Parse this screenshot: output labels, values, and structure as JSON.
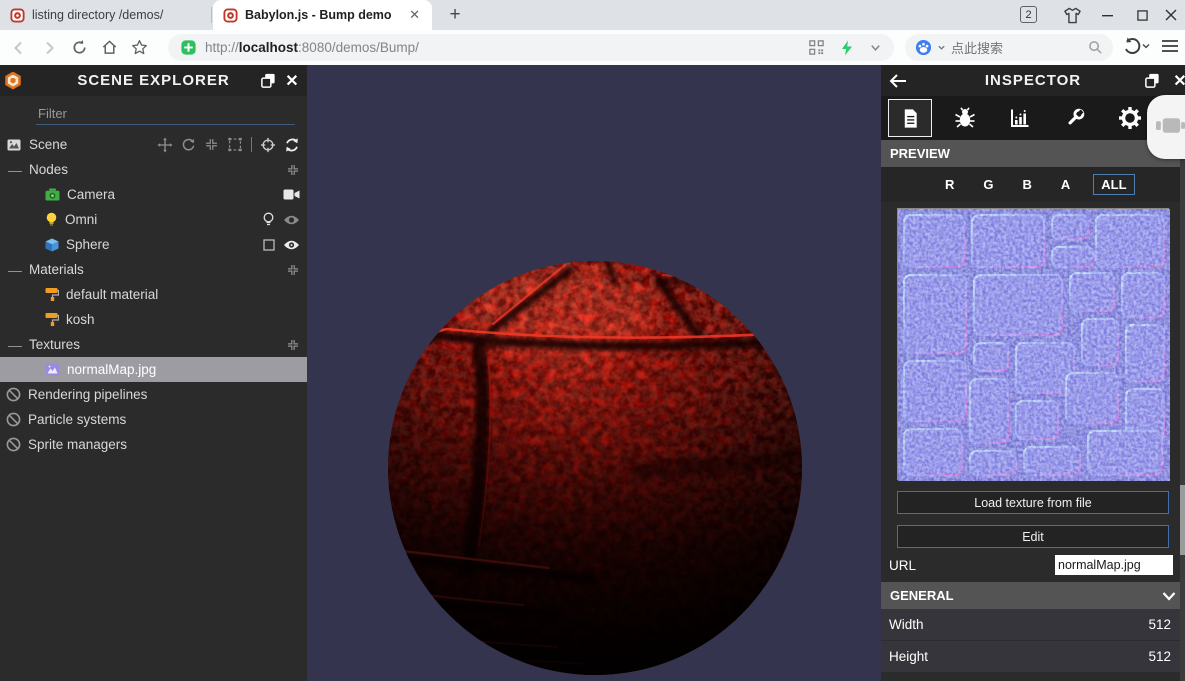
{
  "browser": {
    "tabs": [
      {
        "title": "listing directory /demos/"
      },
      {
        "title": "Babylon.js - Bump demo"
      }
    ],
    "new_tab_label": "+",
    "window_badge": "2",
    "url": {
      "prefix": "http://",
      "host": "localhost",
      "rest": ":8080/demos/Bump/"
    },
    "search_placeholder": "点此搜索"
  },
  "explorer": {
    "title": "SCENE EXPLORER",
    "filter_placeholder": "Filter",
    "rows": [
      {
        "label": "Scene"
      },
      {
        "label": "Nodes"
      },
      {
        "label": "Camera"
      },
      {
        "label": "Omni"
      },
      {
        "label": "Sphere"
      },
      {
        "label": "Materials"
      },
      {
        "label": "default material"
      },
      {
        "label": "kosh"
      },
      {
        "label": "Textures"
      },
      {
        "label": "normalMap.jpg",
        "selected": true
      },
      {
        "label": "Rendering pipelines"
      },
      {
        "label": "Particle systems"
      },
      {
        "label": "Sprite managers"
      }
    ]
  },
  "inspector": {
    "title": "INSPECTOR",
    "preview_header": "PREVIEW",
    "channels": [
      "R",
      "G",
      "B",
      "A",
      "ALL"
    ],
    "active_channel": "ALL",
    "load_button": "Load texture from file",
    "edit_button": "Edit",
    "url_label": "URL",
    "url_value": "normalMap.jpg",
    "general_header": "GENERAL",
    "properties": [
      {
        "label": "Width",
        "value": "512"
      },
      {
        "label": "Height",
        "value": "512"
      }
    ]
  },
  "colors": {
    "canvas_background": "#34344e",
    "panel_background": "#2b2b2b",
    "section_header": "#545454",
    "accent_border": "#3f6fae",
    "selected_row": "#9c9ca2",
    "normal_map_base": "#7678dd",
    "sphere_red": "#d91109"
  }
}
